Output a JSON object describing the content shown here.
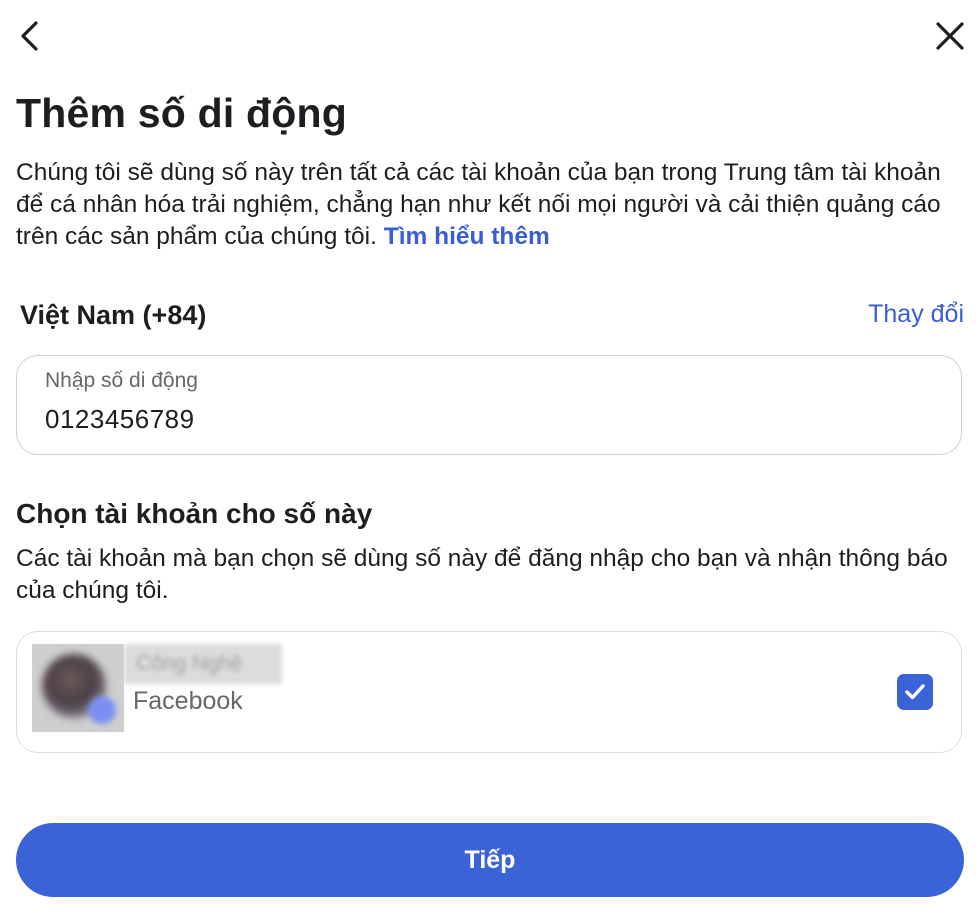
{
  "nav": {
    "back_icon": "chevron-left-icon",
    "close_icon": "close-icon"
  },
  "page": {
    "title": "Thêm số di động",
    "intro_text": "Chúng tôi sẽ dùng số này trên tất cả các tài khoản của bạn trong Trung tâm tài khoản để cá nhân hóa trải nghiệm, chẳng hạn như kết nối mọi người và cải thiện quảng cáo trên các sản phẩm của chúng tôi.",
    "learn_more_link": "Tìm hiểu thêm"
  },
  "country": {
    "label": "Việt Nam (+84)",
    "change_link": "Thay đổi"
  },
  "phone_input": {
    "label": "Nhập số di động",
    "value": "0123456789"
  },
  "accounts_section": {
    "title": "Chọn tài khoản cho số này",
    "description": "Các tài khoản mà bạn chọn sẽ dùng số này để đăng nhập cho bạn và nhận thông báo của chúng tôi.",
    "accounts": [
      {
        "name": "Công Nghệ",
        "type": "Facebook",
        "checked": true
      }
    ]
  },
  "footer": {
    "next_button": "Tiếp"
  },
  "colors": {
    "accent": "#3b63d8",
    "link": "#385dd6",
    "text_primary": "#1c1e21",
    "text_secondary": "#65676b",
    "border": "#ccd0d5"
  }
}
